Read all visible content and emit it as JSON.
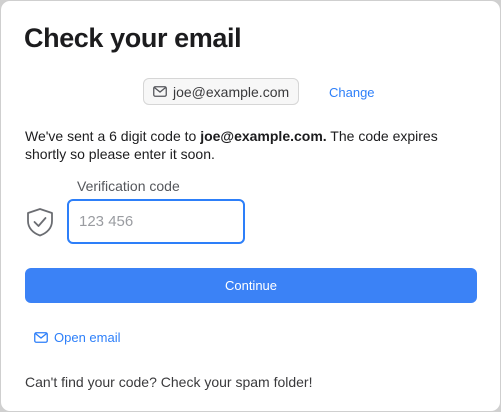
{
  "dialog": {
    "title": "Check your email",
    "email": "joe@example.com",
    "change_label": "Change",
    "message_before": "We've sent a 6 digit code to ",
    "message_email": "joe@example.com.",
    "message_after": "  The code expires shortly so please enter it soon.",
    "code_label": "Verification code",
    "code_placeholder": "123 456",
    "code_value": "",
    "continue_label": "Continue",
    "open_email_label": "Open email",
    "footer": "Can't find your code? Check your spam folder!"
  },
  "icons": {
    "pill_icon": "mail-icon",
    "field_icon": "shield-check-icon",
    "link_icon": "mail-icon"
  },
  "colors": {
    "accent": "#3b82f6",
    "link": "#2d7ff9"
  }
}
